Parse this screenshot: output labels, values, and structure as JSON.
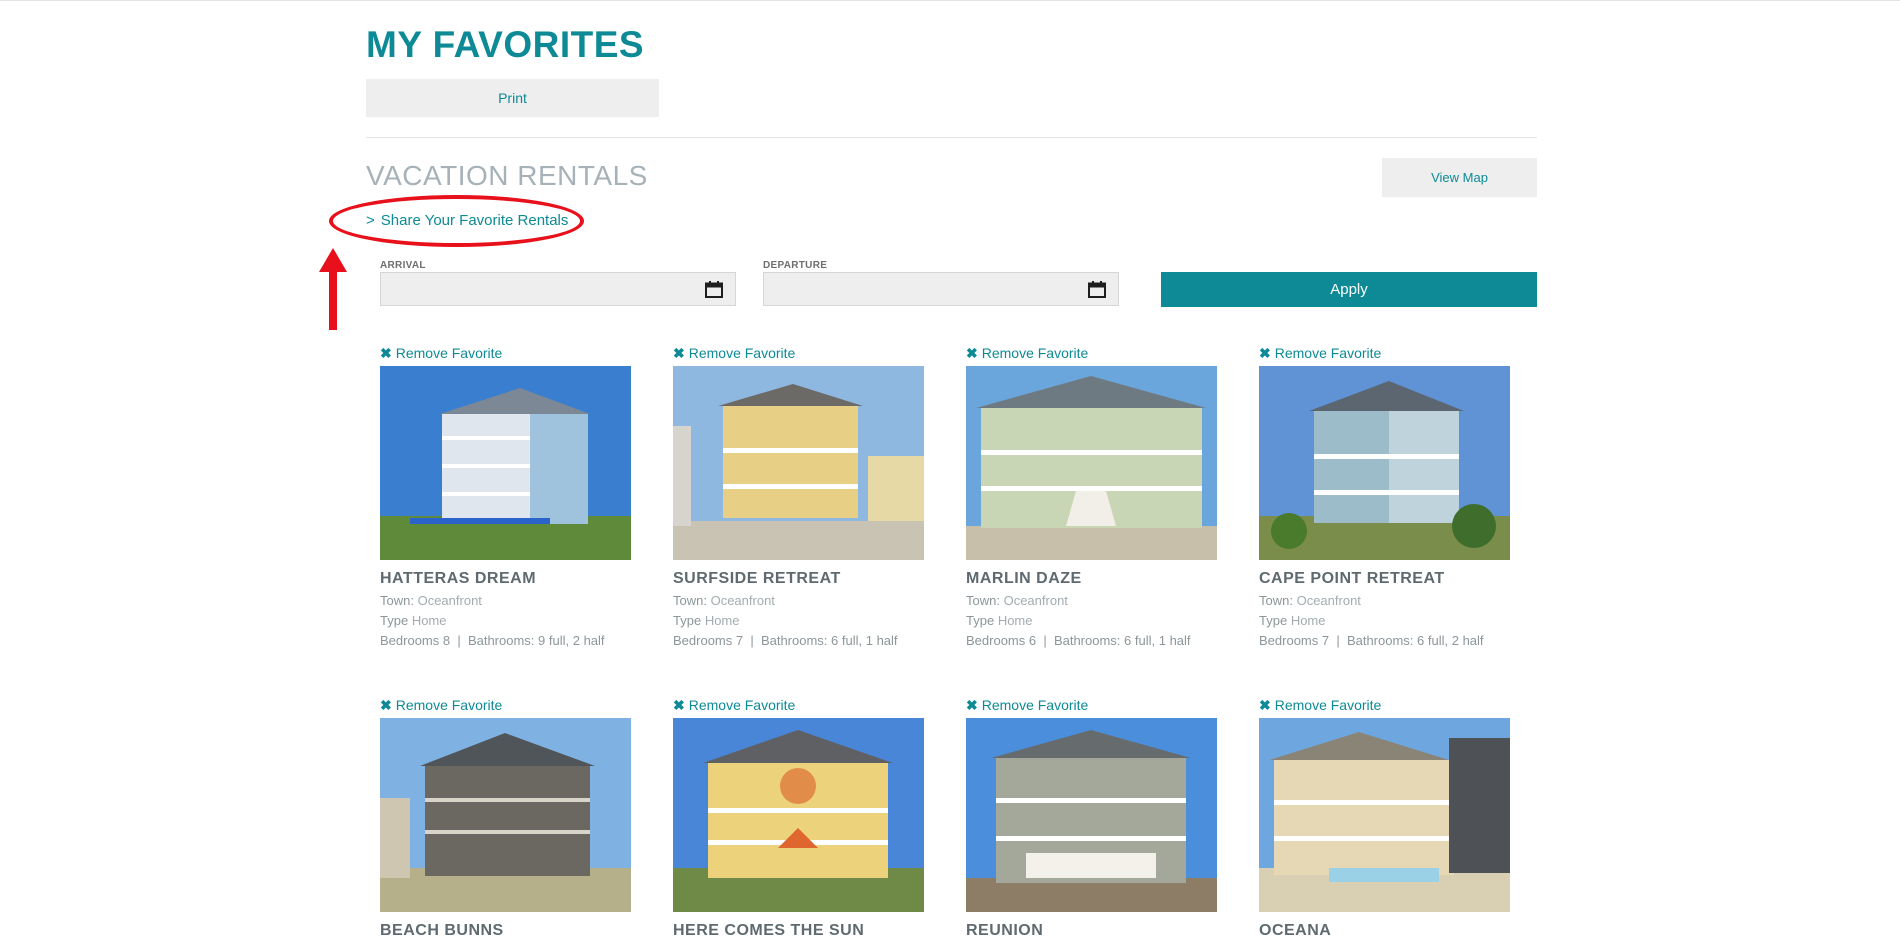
{
  "page": {
    "title": "MY FAVORITES",
    "print_label": "Print",
    "section_title": "VACATION RENTALS",
    "view_map_label": "View Map",
    "share_label": "Share Your Favorite Rentals"
  },
  "search": {
    "arrival_label": "ARRIVAL",
    "departure_label": "DEPARTURE",
    "arrival_value": "",
    "departure_value": "",
    "apply_label": "Apply"
  },
  "labels": {
    "remove_favorite": "Remove Favorite",
    "town": "Town:",
    "type": "Type",
    "bedrooms": "Bedrooms",
    "bathrooms": "Bathrooms:"
  },
  "colors": {
    "accent": "#0d8a96",
    "annotation": "#e8101a"
  },
  "properties": [
    {
      "name": "HATTERAS DREAM",
      "town": "Oceanfront",
      "type": "Home",
      "bedrooms": "8",
      "bathrooms": "9 full, 2 half"
    },
    {
      "name": "SURFSIDE RETREAT",
      "town": "Oceanfront",
      "type": "Home",
      "bedrooms": "7",
      "bathrooms": "6 full, 1 half"
    },
    {
      "name": "MARLIN DAZE",
      "town": "Oceanfront",
      "type": "Home",
      "bedrooms": "6",
      "bathrooms": "6 full, 1 half"
    },
    {
      "name": "CAPE POINT RETREAT",
      "town": "Oceanfront",
      "type": "Home",
      "bedrooms": "7",
      "bathrooms": "6 full, 2 half"
    },
    {
      "name": "BEACH BUNNS"
    },
    {
      "name": "HERE COMES THE SUN"
    },
    {
      "name": "REUNION"
    },
    {
      "name": "OCEANA"
    }
  ]
}
